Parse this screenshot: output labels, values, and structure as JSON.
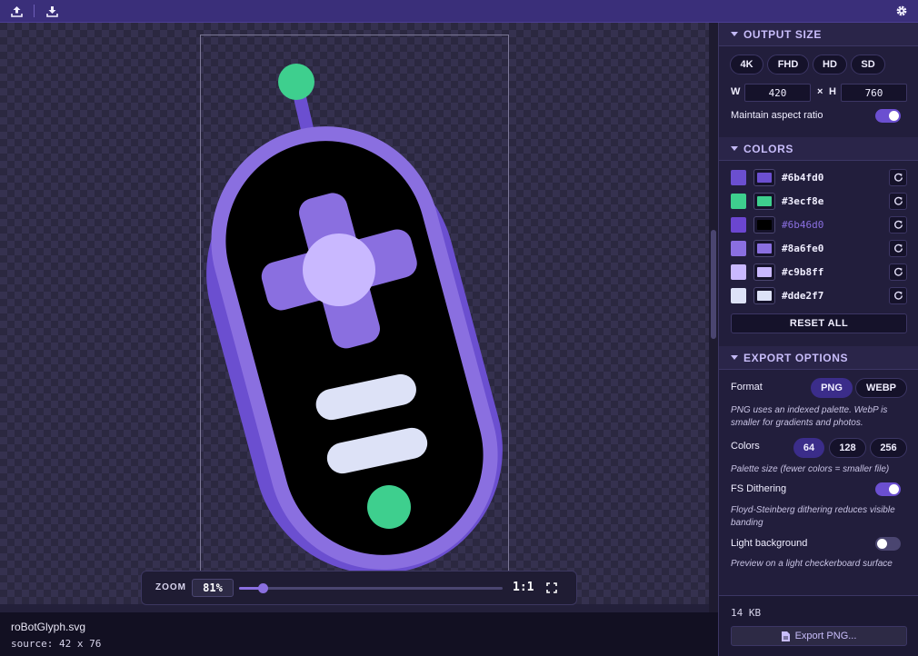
{
  "toolbar": {
    "upload_icon": "upload-icon",
    "download_icon": "download-icon",
    "settings_icon": "gear-icon"
  },
  "canvas": {
    "zoom": {
      "label": "ZOOM",
      "value": "81%",
      "slider_fraction": 0.09,
      "one_to_one_label": "1:1"
    }
  },
  "file": {
    "name": "roBotGlyph.svg",
    "source": "source: 42 x 76"
  },
  "output_size": {
    "title": "OUTPUT SIZE",
    "presets": [
      "4K",
      "FHD",
      "HD",
      "SD"
    ],
    "width_label": "W",
    "width_value": "420",
    "times_label": "×",
    "height_label": "H",
    "height_value": "760",
    "aspect_label": "Maintain aspect ratio",
    "aspect_on": true
  },
  "colors": {
    "title": "COLORS",
    "items": [
      {
        "swatch": "#6b4fd0",
        "picker": "#6b4fd0",
        "hex": "#6b4fd0"
      },
      {
        "swatch": "#3ecf8e",
        "picker": "#3ecf8e",
        "hex": "#3ecf8e"
      },
      {
        "swatch": "#6b46d0",
        "picker": "#000000",
        "hex": "#6b46d0"
      },
      {
        "swatch": "#8a6fe0",
        "picker": "#8a6fe0",
        "hex": "#8a6fe0"
      },
      {
        "swatch": "#c9b8ff",
        "picker": "#c9b8ff",
        "hex": "#c9b8ff"
      },
      {
        "swatch": "#dde2f7",
        "picker": "#dde2f7",
        "hex": "#dde2f7"
      }
    ],
    "reset_all_label": "RESET ALL"
  },
  "export_options": {
    "title": "EXPORT OPTIONS",
    "format_label": "Format",
    "formats": [
      "PNG",
      "WEBP"
    ],
    "format_selected": "PNG",
    "format_hint": "PNG uses an indexed palette. WebP is smaller for gradients and photos.",
    "colors_label": "Colors",
    "color_counts": [
      "64",
      "128",
      "256"
    ],
    "color_count_selected": "64",
    "palette_hint": "Palette size (fewer colors = smaller file)",
    "dithering_label": "FS Dithering",
    "dithering_on": true,
    "dithering_hint": "Floyd-Steinberg dithering reduces visible banding",
    "light_bg_label": "Light background",
    "light_bg_on": false,
    "light_bg_hint": "Preview on a light checkerboard surface"
  },
  "export": {
    "size": "14 KB",
    "button_label": "Export PNG..."
  },
  "theme": {
    "accent": "#6b4fd0",
    "green": "#3ecf8e",
    "topbar": "#3a2f7a",
    "panel": "#221e3c"
  }
}
